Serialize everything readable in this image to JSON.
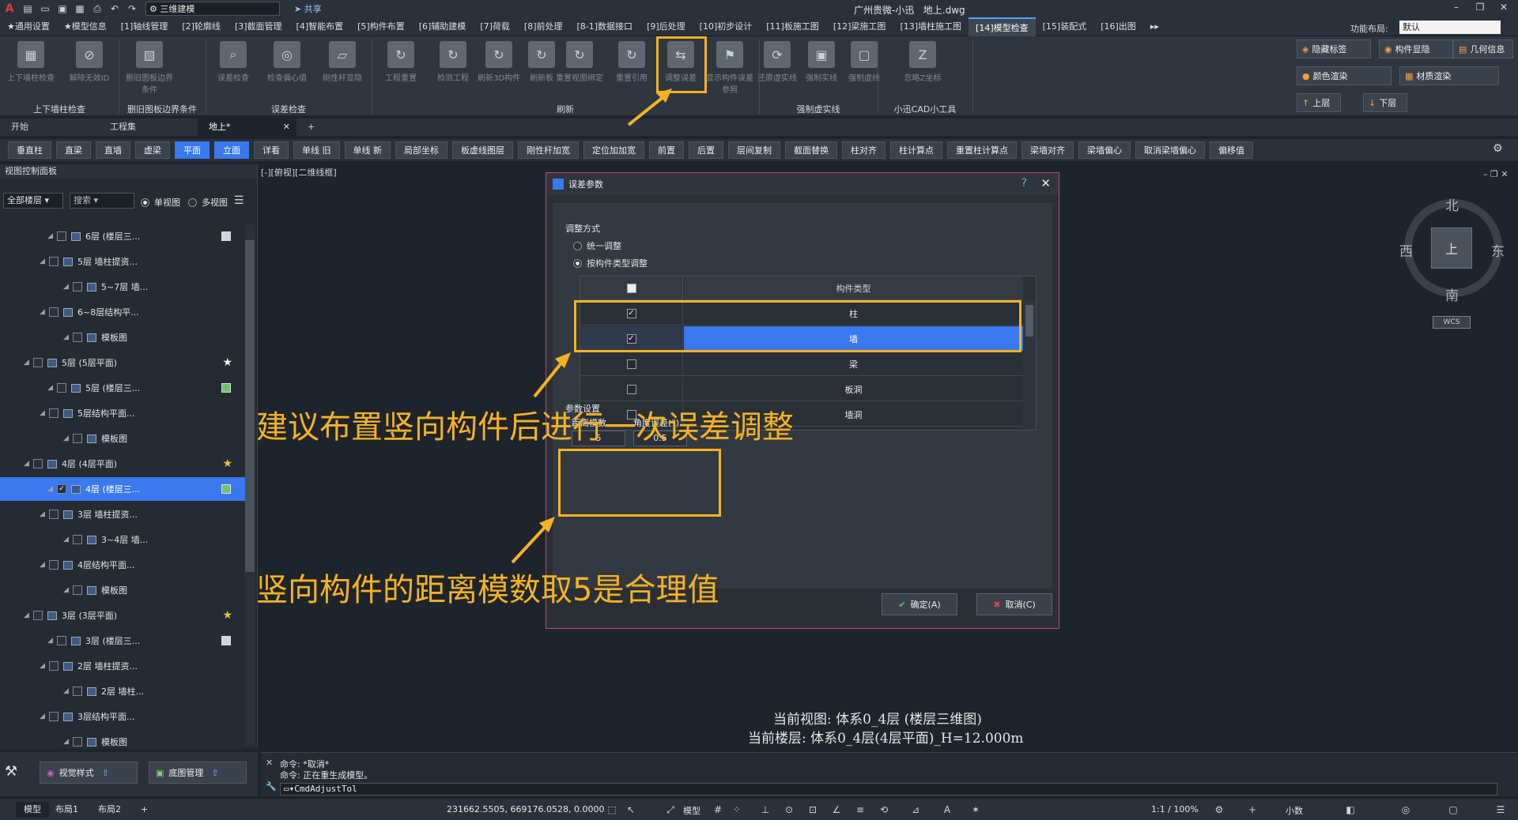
{
  "titlebar": {
    "workspace": "三维建模",
    "share": "共享",
    "app_name": "广州贵微-小迅",
    "file_name": "地上.dwg"
  },
  "ribbon_tabs": [
    "★通用设置",
    "★模型信息",
    "[1]轴线管理",
    "[2]轮廓线",
    "[3]截面管理",
    "[4]智能布置",
    "[5]构件布置",
    "[6]辅助建模",
    "[7]荷载",
    "[8]前处理",
    "[8-1]数据接口",
    "[9]后处理",
    "[10]初步设计",
    "[11]板施工图",
    "[12]梁施工图",
    "[13]墙柱施工图",
    "[14]模型检查",
    "[15]装配式",
    "[16]出图"
  ],
  "active_ribbon_tab": "[14]模型检查",
  "layout": {
    "label": "功能布局:",
    "value": "默认"
  },
  "ribbon": {
    "buttons": [
      {
        "label": "上下墙柱检查",
        "enabled": false
      },
      {
        "label": "解除无效ID",
        "enabled": false
      },
      {
        "label": "删旧图板边界条件",
        "enabled": false
      },
      {
        "label": "误差检查",
        "enabled": false
      },
      {
        "label": "检查偏心值",
        "enabled": false
      },
      {
        "label": "刚性杆显隐",
        "enabled": false
      },
      {
        "label": "工程重置",
        "enabled": false
      },
      {
        "label": "检测工程",
        "enabled": false
      },
      {
        "label": "刷新3D构件",
        "enabled": false
      },
      {
        "label": "刷新板",
        "enabled": false
      },
      {
        "label": "重置视图绑定",
        "enabled": false
      },
      {
        "label": "重置引用",
        "enabled": false
      },
      {
        "label": "调整误差",
        "enabled": false
      },
      {
        "label": "显示构件误差参照",
        "enabled": false
      },
      {
        "label": "还原虚实线",
        "enabled": false
      },
      {
        "label": "强制实线",
        "enabled": false
      },
      {
        "label": "强制虚线",
        "enabled": false
      },
      {
        "label": "忽略Z坐标",
        "enabled": false
      }
    ],
    "groups": [
      "上下墙柱检查",
      "删旧图板边界条件",
      "误差检查",
      "刷新",
      "强制虚实线",
      "小迅CAD小工具"
    ],
    "right_buttons": [
      "隐藏标签",
      "构件显隐",
      "几何信息",
      "颜色渲染",
      "材质渲染",
      "上层",
      "下层"
    ]
  },
  "doc_tabs": [
    "开始",
    "工程集",
    "地上*"
  ],
  "cmd_buttons": [
    "垂直柱",
    "直梁",
    "直墙",
    "虚梁",
    "平面",
    "立面",
    "详看",
    "单线 旧",
    "单线 新",
    "局部坐标",
    "板虚线图层",
    "刚性杆加宽",
    "定位加加宽",
    "前置",
    "后置",
    "层间复制",
    "截面替换",
    "柱对齐",
    "柱计算点",
    "重置柱计算点",
    "梁墙对齐",
    "梁墙偏心",
    "取消梁墙偏心",
    "偏移值"
  ],
  "left_panel": {
    "title": "视图控制面板",
    "floor_filter": "全部楼层",
    "search_placeholder": "搜索",
    "view_single": "单视图",
    "view_multi": "多视图",
    "tree": [
      {
        "label": "6层 (楼层三...",
        "badge": "white"
      },
      {
        "label": "5层 墙柱提资...",
        "badge": ""
      },
      {
        "label": "5~7层 墙...",
        "badge": ""
      },
      {
        "label": "6~8层结构平...",
        "badge": ""
      },
      {
        "label": "模板图",
        "badge": ""
      },
      {
        "label": "5层 (5层平面)",
        "badge": "star-white"
      },
      {
        "label": "5层 (楼层三...",
        "badge": "green"
      },
      {
        "label": "5层结构平面...",
        "badge": ""
      },
      {
        "label": "模板图",
        "badge": ""
      },
      {
        "label": "4层 (4层平面)",
        "badge": "star"
      },
      {
        "label": "4层 (楼层三...",
        "badge": "green",
        "selected": true
      },
      {
        "label": "3层 墙柱提资...",
        "badge": ""
      },
      {
        "label": "3~4层 墙...",
        "badge": ""
      },
      {
        "label": "4层结构平面...",
        "badge": ""
      },
      {
        "label": "模板图",
        "badge": ""
      },
      {
        "label": "3层 (3层平面)",
        "badge": "star"
      },
      {
        "label": "3层 (楼层三...",
        "badge": "white"
      },
      {
        "label": "2层 墙柱提资...",
        "badge": ""
      },
      {
        "label": "2层 墙柱...",
        "badge": ""
      },
      {
        "label": "3层结构平面...",
        "badge": ""
      },
      {
        "label": "模板图",
        "badge": ""
      }
    ],
    "bottom_buttons": [
      "视觉样式",
      "底图管理"
    ]
  },
  "view_label": "[-][俯视][二维线框]",
  "dialog": {
    "title": "误差参数",
    "mode_label": "调整方式",
    "mode_options": [
      "统一调整",
      "按构件类型调整"
    ],
    "mode_selected": 1,
    "table_header": "构件类型",
    "rows": [
      {
        "name": "柱",
        "checked": true
      },
      {
        "name": "墙",
        "checked": true,
        "selected": true
      },
      {
        "name": "梁",
        "checked": false
      },
      {
        "name": "板洞",
        "checked": false
      },
      {
        "name": "墙洞",
        "checked": false
      }
    ],
    "param_title": "参数设置",
    "distance_label": "距离模数",
    "distance_value": "5",
    "angle_label": "角度误差(°)",
    "angle_value": "0.5",
    "ok": "确定(A)",
    "cancel": "取消(C)"
  },
  "annotations": {
    "a1": "建议布置竖向构件后进行一次误差调整",
    "a2": "竖向构件的距离模数取5是合理值",
    "color": "#f4b223"
  },
  "canvas_status": {
    "view": "当前视图: 体系0_4层 (楼层三维图)",
    "floor": "当前楼层: 体系0_4层(4层平面)_H=12.000m"
  },
  "compass": {
    "n": "北",
    "s": "南",
    "e": "东",
    "w": "西",
    "center": "上",
    "wcs": "WCS"
  },
  "command": {
    "line1": "命令: *取消*",
    "line2": "命令: 正在重生成模型。",
    "input": "CmdAdjustTol"
  },
  "status": {
    "tabs": [
      "模型",
      "布局1",
      "布局2"
    ],
    "coords": "231662.5505, 669176.0528, 0.0000",
    "model": "模型",
    "scale": "1:1 / 100%",
    "units": "小数"
  }
}
